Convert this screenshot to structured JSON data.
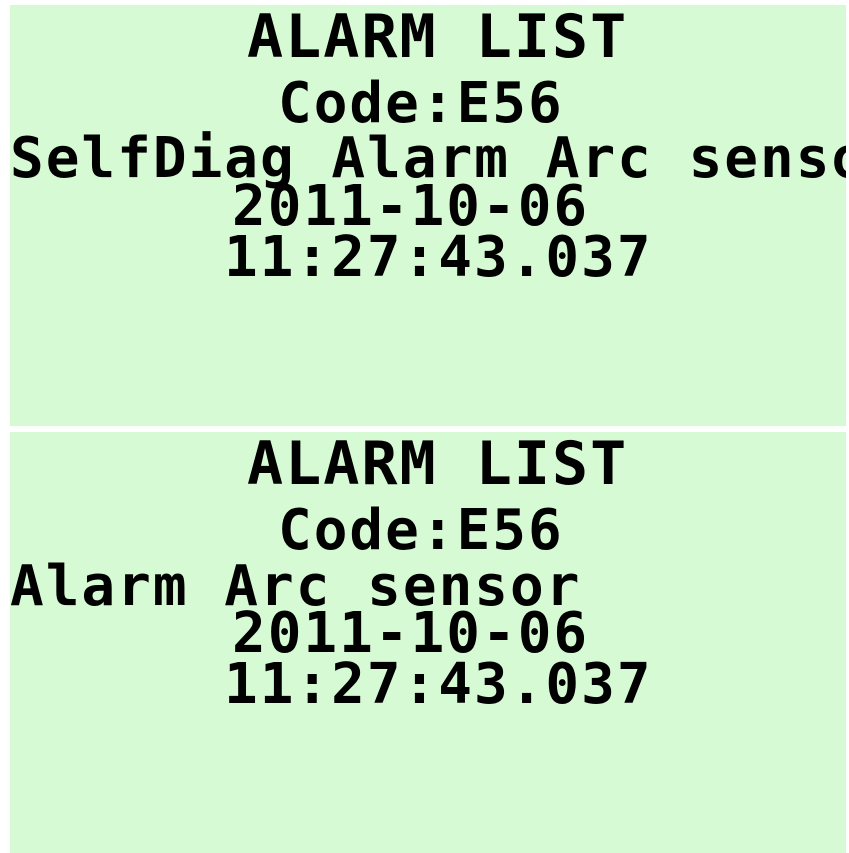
{
  "screens": [
    {
      "title": "ALARM LIST",
      "code": "Code:E56",
      "description": "SelfDiag Alarm Arc sensor",
      "date": "2011-10-06",
      "time": "11:27:43.037"
    },
    {
      "title": "ALARM LIST",
      "code": "Code:E56",
      "description": "Alarm Arc sensor",
      "date": "2011-10-06",
      "time": "11:27:43.037"
    }
  ],
  "colors": {
    "lcd_background": "#d6fad4",
    "text": "#000000",
    "separator": "#ffffff"
  }
}
